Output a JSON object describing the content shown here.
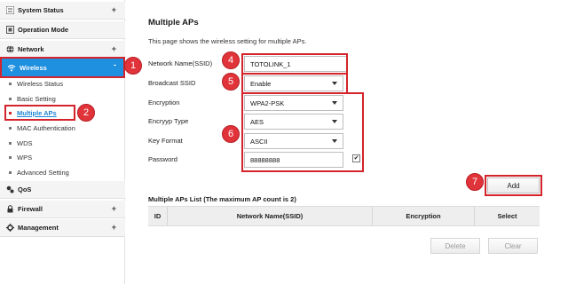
{
  "sidebar": {
    "sections": [
      {
        "label": "System Status",
        "pm": "+"
      },
      {
        "label": "Operation Mode",
        "pm": ""
      },
      {
        "label": "Network",
        "pm": "+"
      },
      {
        "label": "Wireless",
        "pm": "-"
      },
      {
        "label": "QoS",
        "pm": ""
      },
      {
        "label": "Firewall",
        "pm": "+"
      },
      {
        "label": "Management",
        "pm": "+"
      }
    ],
    "wireless_items": [
      "Wireless Status",
      "Basic Setting",
      "Multiple APs",
      "MAC Authentication",
      "WDS",
      "WPS",
      "Advanced Setting"
    ]
  },
  "steps": [
    "1",
    "2",
    "4",
    "5",
    "6",
    "7"
  ],
  "main": {
    "title": "Multiple APs",
    "description": "This page shows the wireless setting for multiple APs.",
    "fields": {
      "ssid_label": "Network Name(SSID)",
      "ssid_value": "TOTOLINK_1",
      "broadcast_label": "Broadcast SSID",
      "broadcast_value": "Enable",
      "encryption_label": "Encryption",
      "encryption_value": "WPA2-PSK",
      "encrypt_type_label": "Encryyp Type",
      "encrypt_type_value": "AES",
      "key_format_label": "Key Format",
      "key_format_value": "ASCII",
      "password_label": "Password",
      "password_value": "88888888"
    },
    "add_button": "Add",
    "list_title": "Multiple APs List (The maximum AP count is 2)",
    "table_headers": [
      "ID",
      "Network Name(SSID)",
      "Encryption",
      "Select"
    ],
    "delete_button": "Delete",
    "clear_button": "Clear"
  },
  "colors": {
    "accent": "#1f8fe0",
    "highlight": "#d4232b",
    "badge": "#e0333a"
  }
}
